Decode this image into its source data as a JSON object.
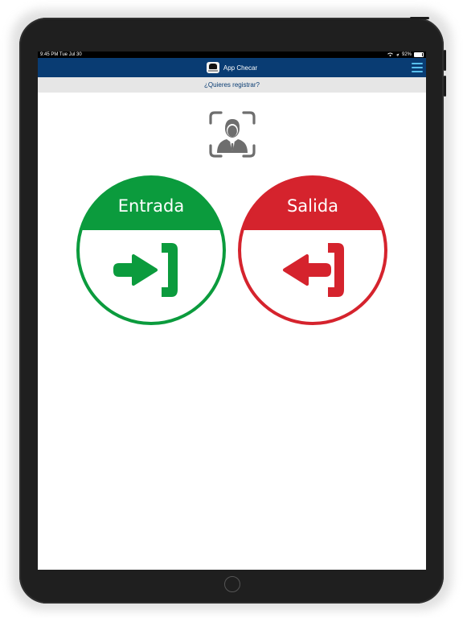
{
  "status_bar": {
    "time_date": "9:45 PM  Tue Jul 30",
    "battery": "92%"
  },
  "nav": {
    "title": "App Checar"
  },
  "sub_bar": {
    "text": "¿Quieres registrar?"
  },
  "buttons": {
    "entry_label": "Entrada",
    "exit_label": "Salida"
  },
  "colors": {
    "nav_bg": "#093c73",
    "menu_icon": "#58c0ee",
    "entry_green": "#0b9b3d",
    "exit_red": "#d5232d",
    "sub_bar_bg": "#e6e6e6",
    "face_icon": "#6e6e6e"
  },
  "icons": {
    "face": "face-scan-icon",
    "entry": "sign-in-arrow-icon",
    "exit": "sign-out-arrow-icon",
    "menu": "hamburger-menu-icon",
    "wifi": "wifi-icon",
    "location": "location-arrow-icon",
    "battery": "battery-icon"
  }
}
